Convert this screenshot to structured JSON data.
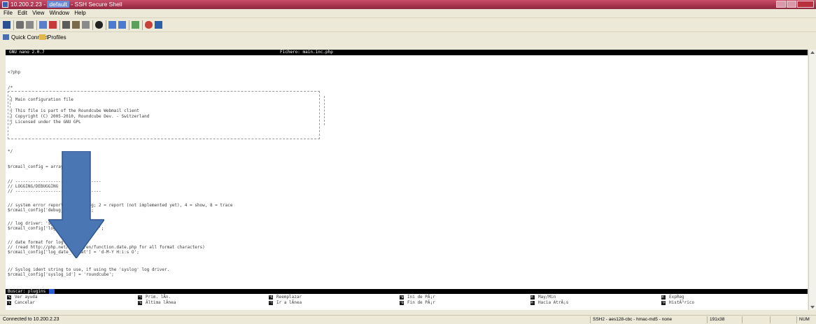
{
  "window": {
    "title_prefix": "10.200.2.23 - ",
    "title_selected": "default",
    "title_suffix": " - SSH Secure Shell"
  },
  "menu": [
    "File",
    "Edit",
    "View",
    "Window",
    "Help"
  ],
  "toolbar_icons": [
    "save-icon",
    "print-icon",
    "print-preview-icon",
    "new-terminal-icon",
    "disconnect-icon",
    "copy-icon",
    "paste-icon",
    "paste-special-icon",
    "find-icon",
    "settings-icon",
    "settings-alt-icon",
    "file-transfer-icon",
    "colors-icon",
    "help-icon"
  ],
  "quickbar": {
    "quick_connect": "Quick Connect",
    "profiles": "Profiles"
  },
  "nano": {
    "version": "GNU nano 2.0.7",
    "file": "Fichero: main.inc.php"
  },
  "code": [
    "<?php",
    "/*",
    " | Main configuration file",
    " | This file is part of the Roundcube Webmail client",
    " | Copyright (C) 2005-2010, Roundcube Dev. - Switzerland",
    " | Licensed under the GNU GPL",
    "*/",
    "$rcmail_config = array();",
    "// ----------------------------------",
    "// LOGGING/DEBUGGING",
    "// ----------------------------------",
    "// system error reporting: 1 = log; 2 = report (not implemented yet), 4 = show, 8 = trace",
    "$rcmail_config['debug_level'] = 1;",
    "// log driver: 'syslog' or 'file'.",
    "$rcmail_config['log_driver'] = 'file';",
    "// date format for log entries",
    "// (read http://php.net/manual/en/function.date.php for all format characters)",
    "$rcmail_config['log_date_format'] = 'd-M-Y H:i:s O';",
    "// Syslog ident string to use, if using the 'syslog' log driver.",
    "$rcmail_config['syslog_id'] = 'roundcube';"
  ],
  "prompt": "Buscar: plugins",
  "shortcuts": [
    {
      "key": "^G",
      "label": "Ver ayuda"
    },
    {
      "key": "^C",
      "label": "Cancelar"
    },
    {
      "key": "^Y",
      "label": "Prim. lÃ­n."
    },
    {
      "key": "^V",
      "label": "Ãltima lÃ­nea"
    },
    {
      "key": "^R",
      "label": "Reemplazar"
    },
    {
      "key": "^T",
      "label": "Ir a lÃ­nea"
    },
    {
      "key": "^W",
      "label": "Ini de PÃ¡r"
    },
    {
      "key": "^O",
      "label": "Fin de PÃ¡r"
    },
    {
      "key": "M-C",
      "label": "May/Min"
    },
    {
      "key": "M-B",
      "label": "Hacia AtrÃ¡s"
    },
    {
      "key": "M-R",
      "label": "ExpReg"
    },
    {
      "key": "^P",
      "label": "HistÃ³rico"
    }
  ],
  "status": {
    "connected": "Connected to 10.200.2.23",
    "cipher": "SSH2 - aes128-cbc - hmac-md5 - none",
    "size": "191x38",
    "num": "NUM"
  },
  "colors": {
    "title": "#a8324d",
    "arrow": "#4a76b4",
    "cursor": "#2a5cd6"
  }
}
